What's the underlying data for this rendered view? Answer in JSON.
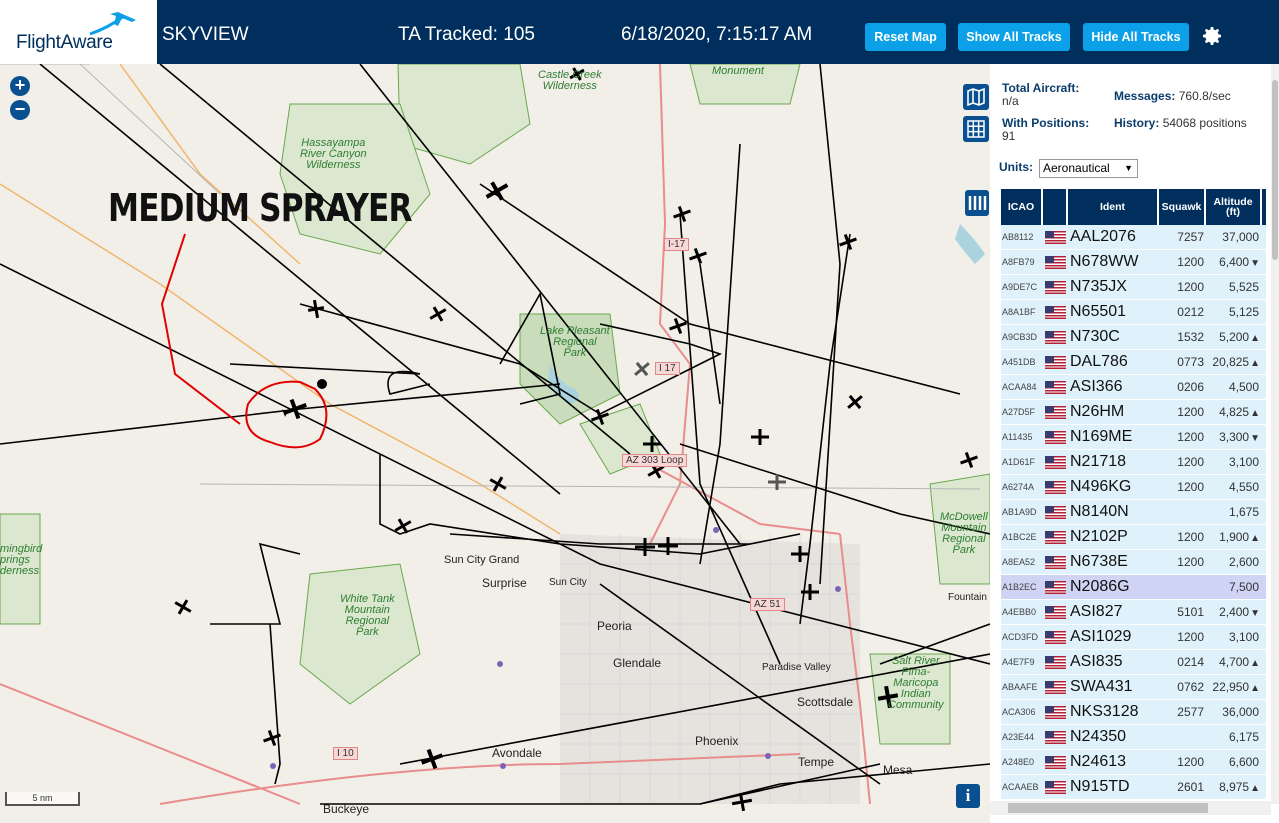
{
  "header": {
    "brand": "FlightAware",
    "app_name": "SKYVIEW",
    "tracked_label": "TA Tracked:",
    "tracked_count": "105",
    "clock": "6/18/2020, 7:15:17 AM",
    "buttons": {
      "reset": "Reset Map",
      "show": "Show All Tracks",
      "hide": "Hide All Tracks"
    },
    "settings_icon": "gear-icon"
  },
  "map": {
    "overlay_label": "MEDIUM SPRAYER",
    "scale": "5 nm",
    "zoom_in": "+",
    "zoom_out": "−",
    "info": "i",
    "places": {
      "castle_creek": "Castle Creek\nWilderness",
      "monument": "Monument",
      "hassayampa": "Hassayampa\nRiver Canyon\nWilderness",
      "lake_pleasant": "Lake Pleasant\nRegional\nPark",
      "white_tank": "White Tank\nMountain\nRegional\nPark",
      "mcdowell": "McDowell\nMountain\nRegional\nPark",
      "hummingbird": "mingbird\nprings\nderness",
      "salt_river": "Salt River\nPima-\nMaricopa\nIndian\nCommunity"
    },
    "cities": {
      "sun_city_grand": "Sun City Grand",
      "surprise": "Surprise",
      "sun_city": "Sun City",
      "peoria": "Peoria",
      "glendale": "Glendale",
      "paradise_valley": "Paradise Valley",
      "scottsdale": "Scottsdale",
      "phoenix": "Phoenix",
      "avondale": "Avondale",
      "tempe": "Tempe",
      "mesa": "Mesa",
      "buckeye": "Buckeye",
      "fountain": "Fountain"
    },
    "shields": {
      "i17a": "I-17",
      "i17b": "I 17",
      "az303": "AZ 303 Loop",
      "az51": "AZ 51",
      "i10": "I 10"
    }
  },
  "stats": {
    "total_label": "Total Aircraft:",
    "total_value": "n/a",
    "positions_label": "With Positions:",
    "positions_value": "91",
    "messages_label": "Messages:",
    "messages_value": "760.8/sec",
    "history_label": "History:",
    "history_value": "54068 positions"
  },
  "units": {
    "label": "Units:",
    "selected": "Aeronautical"
  },
  "table": {
    "headers": {
      "icao": "ICAO",
      "ident": "Ident",
      "squawk": "Squawk",
      "altitude": "Altitude\n(ft)"
    },
    "rows": [
      {
        "icao": "AB8112",
        "ident": "AAL2076",
        "squawk": "7257",
        "alt": "37,000",
        "trend": ""
      },
      {
        "icao": "A8FB79",
        "ident": "N678WW",
        "squawk": "1200",
        "alt": "6,400",
        "trend": "▼"
      },
      {
        "icao": "A9DE7C",
        "ident": "N735JX",
        "squawk": "1200",
        "alt": "5,525",
        "trend": ""
      },
      {
        "icao": "A8A1BF",
        "ident": "N65501",
        "squawk": "0212",
        "alt": "5,125",
        "trend": ""
      },
      {
        "icao": "A9CB3D",
        "ident": "N730C",
        "squawk": "1532",
        "alt": "5,200",
        "trend": "▲"
      },
      {
        "icao": "A451DB",
        "ident": "DAL786",
        "squawk": "0773",
        "alt": "20,825",
        "trend": "▲"
      },
      {
        "icao": "ACAA84",
        "ident": "ASI366",
        "squawk": "0206",
        "alt": "4,500",
        "trend": ""
      },
      {
        "icao": "A27D5F",
        "ident": "N26HM",
        "squawk": "1200",
        "alt": "4,825",
        "trend": "▲"
      },
      {
        "icao": "A11435",
        "ident": "N169ME",
        "squawk": "1200",
        "alt": "3,300",
        "trend": "▼"
      },
      {
        "icao": "A1D61F",
        "ident": "N21718",
        "squawk": "1200",
        "alt": "3,100",
        "trend": ""
      },
      {
        "icao": "A6274A",
        "ident": "N496KG",
        "squawk": "1200",
        "alt": "4,550",
        "trend": ""
      },
      {
        "icao": "AB1A9D",
        "ident": "N8140N",
        "squawk": "",
        "alt": "1,675",
        "trend": ""
      },
      {
        "icao": "A1BC2E",
        "ident": "N2102P",
        "squawk": "1200",
        "alt": "1,900",
        "trend": "▲"
      },
      {
        "icao": "A8EA52",
        "ident": "N6738E",
        "squawk": "1200",
        "alt": "2,600",
        "trend": ""
      },
      {
        "icao": "A1B2EC",
        "ident": "N2086G",
        "squawk": "",
        "alt": "7,500",
        "trend": ""
      },
      {
        "icao": "A4EBB0",
        "ident": "ASI827",
        "squawk": "5101",
        "alt": "2,400",
        "trend": "▼"
      },
      {
        "icao": "ACD3FD",
        "ident": "ASI1029",
        "squawk": "1200",
        "alt": "3,100",
        "trend": ""
      },
      {
        "icao": "A4E7F9",
        "ident": "ASI835",
        "squawk": "0214",
        "alt": "4,700",
        "trend": "▲"
      },
      {
        "icao": "ABAAFE",
        "ident": "SWA431",
        "squawk": "0762",
        "alt": "22,950",
        "trend": "▲"
      },
      {
        "icao": "ACA306",
        "ident": "NKS3128",
        "squawk": "2577",
        "alt": "36,000",
        "trend": ""
      },
      {
        "icao": "A23E44",
        "ident": "N24350",
        "squawk": "",
        "alt": "6,175",
        "trend": ""
      },
      {
        "icao": "A248E0",
        "ident": "N24613",
        "squawk": "1200",
        "alt": "6,600",
        "trend": ""
      },
      {
        "icao": "ACAAEB",
        "ident": "N915TD",
        "squawk": "2601",
        "alt": "8,975",
        "trend": "▲"
      }
    ],
    "selected_index": 14
  },
  "colors": {
    "header_bg": "#002f5d",
    "button_bg": "#0ba0e8",
    "row_bg": "#dff1fb",
    "row_selected": "#cfd4f5",
    "highlight": "#e00000"
  }
}
